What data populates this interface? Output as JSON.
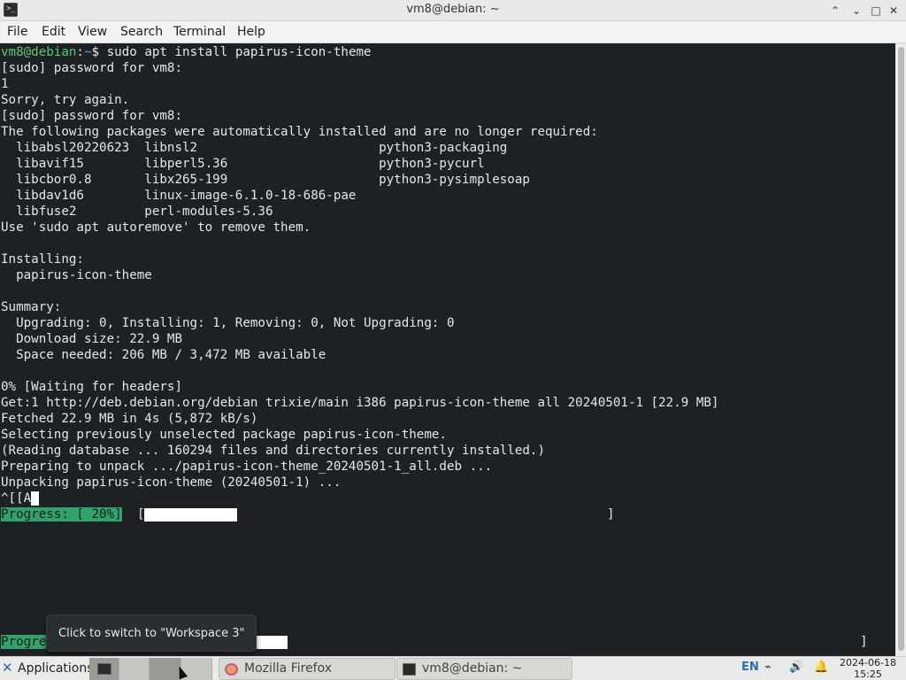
{
  "window": {
    "title": "vm8@debian: ~",
    "minimize_glyph": "⌃",
    "restore_glyph": "⌄",
    "maximize_glyph": "□",
    "close_glyph": "✕"
  },
  "menu": {
    "file": "File",
    "edit": "Edit",
    "view": "View",
    "search": "Search",
    "terminal": "Terminal",
    "help": "Help"
  },
  "terminal": {
    "prompt_user": "vm8@debian",
    "prompt_sep": ":",
    "prompt_path": "~",
    "prompt_end": "$ ",
    "command": "sudo apt install papirus-icon-theme",
    "lines": [
      "[sudo] password for vm8:",
      "1",
      "Sorry, try again.",
      "[sudo] password for vm8:",
      "The following packages were automatically installed and are no longer required:",
      "  libabsl20220623  libnsl2                        python3-packaging",
      "  libavif15        libperl5.36                    python3-pycurl",
      "  libcbor0.8       libx265-199                    python3-pysimplesoap",
      "  libdav1d6        linux-image-6.1.0-18-686-pae",
      "  libfuse2         perl-modules-5.36",
      "Use 'sudo apt autoremove' to remove them.",
      "",
      "Installing:",
      "  papirus-icon-theme",
      "",
      "Summary:",
      "  Upgrading: 0, Installing: 1, Removing: 0, Not Upgrading: 0",
      "  Download size: 22.9 MB",
      "  Space needed: 206 MB / 3,472 MB available",
      "",
      "0% [Waiting for headers]",
      "Get:1 http://deb.debian.org/debian trixie/main i386 papirus-icon-theme all 20240501-1 [22.9 MB]",
      "Fetched 22.9 MB in 4s (5,872 kB/s)",
      "Selecting previously unselected package papirus-icon-theme.",
      "(Reading database ... 160294 files and directories currently installed.)",
      "Preparing to unpack .../papirus-icon-theme_20240501-1_all.deb ...",
      "Unpacking papirus-icon-theme (20240501-1) ..."
    ],
    "escape_text": "^[[A",
    "progress_label": "Progress: [ 20%]",
    "progress_fraction": 0.2,
    "bottom_progress_label": "Progre",
    "bar_open": "[",
    "bar_close": "]"
  },
  "tooltip": {
    "text": "Click to switch to \"Workspace 3\""
  },
  "taskbar": {
    "applications_label": "Applications",
    "tasks": [
      {
        "label": "Mozilla Firefox"
      },
      {
        "label": "vm8@debian: ~"
      }
    ],
    "language": "EN",
    "clock_date": "2024-06-18",
    "clock_time": "15:25"
  },
  "colors": {
    "terminal_bg": "#1e2124",
    "prompt_user": "#59c873",
    "prompt_path": "#5d9fd6",
    "progress_green": "#2fa36b"
  }
}
